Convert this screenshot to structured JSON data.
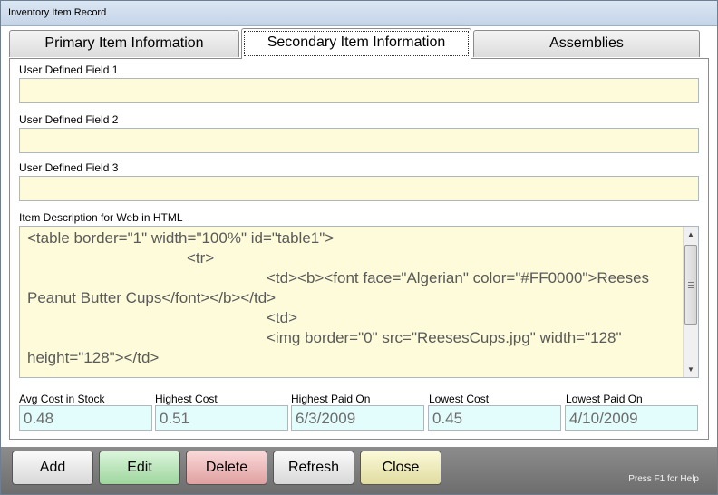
{
  "window": {
    "title": "Inventory Item Record"
  },
  "tabs": [
    {
      "label": "Primary Item Information",
      "active": false
    },
    {
      "label": "Secondary Item Information",
      "active": true
    },
    {
      "label": "Assemblies",
      "active": false
    }
  ],
  "user_fields": [
    {
      "label": "User Defined Field 1",
      "value": ""
    },
    {
      "label": "User Defined Field 2",
      "value": ""
    },
    {
      "label": "User Defined Field 3",
      "value": ""
    }
  ],
  "web_description": {
    "label": "Item Description for Web in HTML",
    "value": "<table border=\"1\" width=\"100%\" id=\"table1\">\n\t\t<tr>\n\t\t\t<td><b><font face=\"Algerian\" color=\"#FF0000\">Reeses Peanut Butter Cups</font></b></td>\n\t\t\t<td>\n\t\t\t<img border=\"0\" src=\"ReesesCups.jpg\" width=\"128\" height=\"128\"></td>"
  },
  "stats": [
    {
      "label": "Avg Cost in Stock",
      "value": "0.48"
    },
    {
      "label": "Highest Cost",
      "value": "0.51"
    },
    {
      "label": "Highest Paid On",
      "value": "6/3/2009"
    },
    {
      "label": "Lowest Cost",
      "value": "0.45"
    },
    {
      "label": "Lowest Paid On",
      "value": "4/10/2009"
    }
  ],
  "buttons": {
    "add": "Add",
    "edit": "Edit",
    "delete": "Delete",
    "refresh": "Refresh",
    "close": "Close"
  },
  "help_text": "Press F1 for Help",
  "icons": {
    "scroll_up": "scroll-up-arrow-icon",
    "scroll_down": "scroll-down-arrow-icon"
  },
  "colors": {
    "input_background": "#fdfbd9",
    "readonly_background": "#e3fcfc",
    "edit_button": "#9ed59e",
    "delete_button": "#e0a0a0",
    "close_button": "#e0dca0"
  }
}
